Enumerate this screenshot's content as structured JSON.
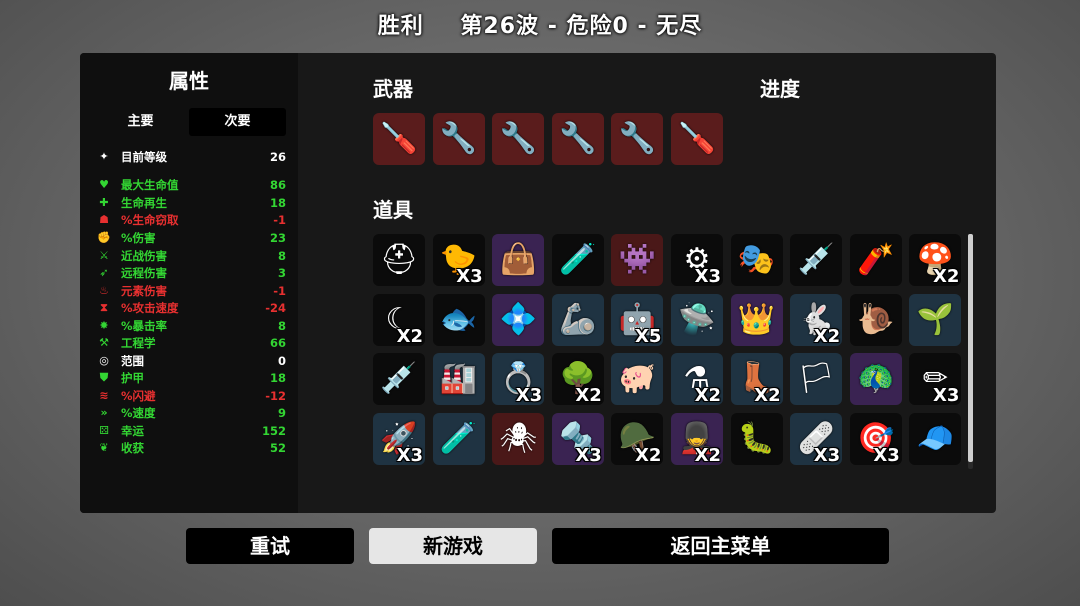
{
  "header": {
    "result": "胜利",
    "wave_info": "第26波 - 危险0 - 无尽"
  },
  "stats": {
    "title": "属性",
    "tabs": [
      "主要",
      "次要"
    ],
    "active_tab": 1,
    "rows": [
      {
        "icon": "level-icon",
        "glyph": "✦",
        "label": "目前等级",
        "value": "26",
        "color": "w"
      },
      {
        "icon": "heart-icon",
        "glyph": "♥",
        "label": "最大生命值",
        "value": "86",
        "color": "g"
      },
      {
        "icon": "regen-icon",
        "glyph": "✚",
        "label": "生命再生",
        "value": "18",
        "color": "g"
      },
      {
        "icon": "lifesteal-icon",
        "glyph": "☗",
        "label": "%生命窃取",
        "value": "-1",
        "color": "r"
      },
      {
        "icon": "damage-icon",
        "glyph": "✊",
        "label": "%伤害",
        "value": "23",
        "color": "g"
      },
      {
        "icon": "melee-icon",
        "glyph": "⚔",
        "label": "近战伤害",
        "value": "8",
        "color": "g"
      },
      {
        "icon": "ranged-icon",
        "glyph": "➶",
        "label": "远程伤害",
        "value": "3",
        "color": "g"
      },
      {
        "icon": "elemental-icon",
        "glyph": "♨",
        "label": "元素伤害",
        "value": "-1",
        "color": "r"
      },
      {
        "icon": "attack-speed-icon",
        "glyph": "⧗",
        "label": "%攻击速度",
        "value": "-24",
        "color": "r"
      },
      {
        "icon": "crit-icon",
        "glyph": "✸",
        "label": "%暴击率",
        "value": "8",
        "color": "g"
      },
      {
        "icon": "engineering-icon",
        "glyph": "⚒",
        "label": "工程学",
        "value": "66",
        "color": "g"
      },
      {
        "icon": "range-icon",
        "glyph": "◎",
        "label": "范围",
        "value": "0",
        "color": "w"
      },
      {
        "icon": "armor-icon",
        "glyph": "⛊",
        "label": "护甲",
        "value": "18",
        "color": "g"
      },
      {
        "icon": "dodge-icon",
        "glyph": "≋",
        "label": "%闪避",
        "value": "-12",
        "color": "r"
      },
      {
        "icon": "speed-icon",
        "glyph": "»",
        "label": "%速度",
        "value": "9",
        "color": "g"
      },
      {
        "icon": "luck-icon",
        "glyph": "⚄",
        "label": "幸运",
        "value": "152",
        "color": "g"
      },
      {
        "icon": "harvest-icon",
        "glyph": "❦",
        "label": "收获",
        "value": "52",
        "color": "g"
      }
    ]
  },
  "weapons": {
    "title": "武器",
    "items": [
      {
        "name": "screwdriver-icon",
        "glyph": "🪛"
      },
      {
        "name": "wrench-icon",
        "glyph": "🔧"
      },
      {
        "name": "wrench-icon",
        "glyph": "🔧"
      },
      {
        "name": "wrench-icon",
        "glyph": "🔧"
      },
      {
        "name": "wrench-icon",
        "glyph": "🔧"
      },
      {
        "name": "screwdriver-icon",
        "glyph": "🪛"
      }
    ]
  },
  "progress": {
    "title": "进度"
  },
  "items": {
    "title": "道具",
    "grid": [
      {
        "name": "helmet-icon",
        "glyph": "⛑",
        "tier": "t0",
        "count": ""
      },
      {
        "name": "duck-icon",
        "glyph": "🐤",
        "tier": "t0",
        "count": "X3"
      },
      {
        "name": "bag-icon",
        "glyph": "👜",
        "tier": "t2",
        "count": ""
      },
      {
        "name": "potion-icon",
        "glyph": "🧪",
        "tier": "t0",
        "count": ""
      },
      {
        "name": "alien-icon",
        "glyph": "👾",
        "tier": "t3",
        "count": ""
      },
      {
        "name": "turret-icon",
        "glyph": "⚙",
        "tier": "t0",
        "count": "X3"
      },
      {
        "name": "mask-icon",
        "glyph": "🎭",
        "tier": "t0",
        "count": ""
      },
      {
        "name": "syringe-icon",
        "glyph": "💉",
        "tier": "t0",
        "count": ""
      },
      {
        "name": "dynamite-icon",
        "glyph": "🧨",
        "tier": "t0",
        "count": ""
      },
      {
        "name": "mushroom-icon",
        "glyph": "🍄",
        "tier": "t0",
        "count": "X2"
      },
      {
        "name": "claw-icon",
        "glyph": "☾",
        "tier": "t0",
        "count": "X2"
      },
      {
        "name": "fish-icon",
        "glyph": "🐟",
        "tier": "t0",
        "count": ""
      },
      {
        "name": "gem-icon",
        "glyph": "💠",
        "tier": "t2",
        "count": ""
      },
      {
        "name": "arm-icon",
        "glyph": "🦾",
        "tier": "t1",
        "count": ""
      },
      {
        "name": "robot-icon",
        "glyph": "🤖",
        "tier": "t1",
        "count": "X5"
      },
      {
        "name": "drone-icon",
        "glyph": "🛸",
        "tier": "t1",
        "count": ""
      },
      {
        "name": "crown-icon",
        "glyph": "👑",
        "tier": "t2",
        "count": ""
      },
      {
        "name": "rabbit-icon",
        "glyph": "🐇",
        "tier": "t1",
        "count": "X2"
      },
      {
        "name": "snail-icon",
        "glyph": "🐌",
        "tier": "t0",
        "count": ""
      },
      {
        "name": "garden-icon",
        "glyph": "🌱",
        "tier": "t1",
        "count": ""
      },
      {
        "name": "injection-icon",
        "glyph": "💉",
        "tier": "t0",
        "count": ""
      },
      {
        "name": "machine-icon",
        "glyph": "🏭",
        "tier": "t1",
        "count": ""
      },
      {
        "name": "ring-icon",
        "glyph": "💍",
        "tier": "t1",
        "count": "X3"
      },
      {
        "name": "tree-icon",
        "glyph": "🌳",
        "tier": "t0",
        "count": "X2"
      },
      {
        "name": "pig-icon",
        "glyph": "🐖",
        "tier": "t1",
        "count": ""
      },
      {
        "name": "flask-icon",
        "glyph": "⚗",
        "tier": "t1",
        "count": "X2"
      },
      {
        "name": "boot-icon",
        "glyph": "👢",
        "tier": "t1",
        "count": "X2"
      },
      {
        "name": "flag-icon",
        "glyph": "🏳",
        "tier": "t1",
        "count": ""
      },
      {
        "name": "peacock-icon",
        "glyph": "🦚",
        "tier": "t2",
        "count": ""
      },
      {
        "name": "pencil-icon",
        "glyph": "✏",
        "tier": "t0",
        "count": "X3"
      },
      {
        "name": "bullet-icon",
        "glyph": "🚀",
        "tier": "t1",
        "count": "X3"
      },
      {
        "name": "green-potion-icon",
        "glyph": "🧪",
        "tier": "t1",
        "count": ""
      },
      {
        "name": "mech-icon",
        "glyph": "🕷",
        "tier": "t3",
        "count": ""
      },
      {
        "name": "scrap-icon",
        "glyph": "🔩",
        "tier": "t2",
        "count": "X3"
      },
      {
        "name": "iron-helmet-icon",
        "glyph": "🪖",
        "tier": "t0",
        "count": "X2"
      },
      {
        "name": "soldier-icon",
        "glyph": "💂",
        "tier": "t2",
        "count": "X2"
      },
      {
        "name": "worm-icon",
        "glyph": "🐛",
        "tier": "t0",
        "count": ""
      },
      {
        "name": "medkit-icon",
        "glyph": "🩹",
        "tier": "t1",
        "count": "X3"
      },
      {
        "name": "target-icon",
        "glyph": "🎯",
        "tier": "t0",
        "count": "X3"
      },
      {
        "name": "propeller-hat-icon",
        "glyph": "🧢",
        "tier": "t0",
        "count": ""
      }
    ]
  },
  "buttons": {
    "retry": "重试",
    "new_game": "新游戏",
    "main_menu": "返回主菜单"
  }
}
